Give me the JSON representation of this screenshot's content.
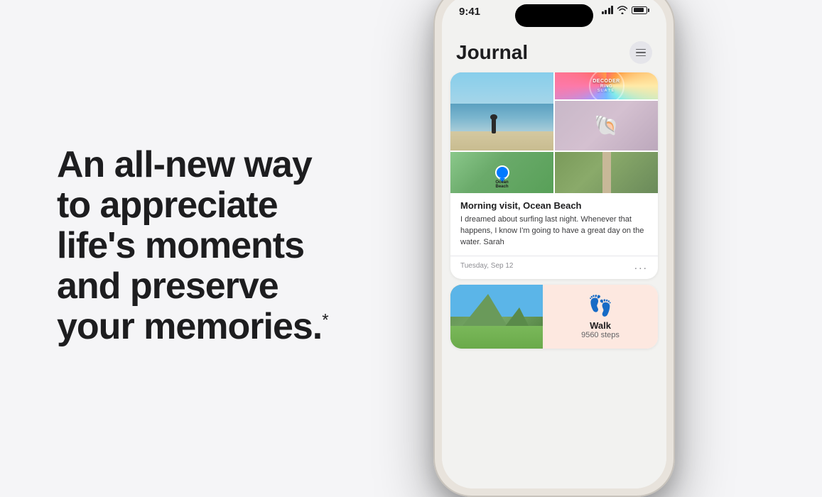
{
  "page": {
    "background": "#f5f5f7"
  },
  "left": {
    "headline_line1": "An all-new way",
    "headline_line2": "to appreciate",
    "headline_line3": "life's moments",
    "headline_line4": "and preserve",
    "headline_line5": "your memories.",
    "footnote_marker": "*"
  },
  "phone": {
    "status_time": "9:41",
    "app_title": "Journal",
    "menu_icon": "≡",
    "card1": {
      "images": {
        "main_alt": "Beach with person surfing",
        "podcast_line1": "DECODER",
        "podcast_line2": "RING",
        "podcast_source": "SLATE",
        "shell_alt": "Seashell",
        "map_label": "Ocean\nBeach",
        "road_alt": "Road through vineyards"
      },
      "title": "Morning visit, Ocean Beach",
      "body": "I dreamed about surfing last night. Whenever that happens, I know I'm going to have a great day on the water. Sarah",
      "date": "Tuesday, Sep 12",
      "more_dots": "..."
    },
    "card2": {
      "image_alt": "Mountain landscape",
      "walk_label": "Walk",
      "walk_steps": "9560 steps"
    }
  }
}
